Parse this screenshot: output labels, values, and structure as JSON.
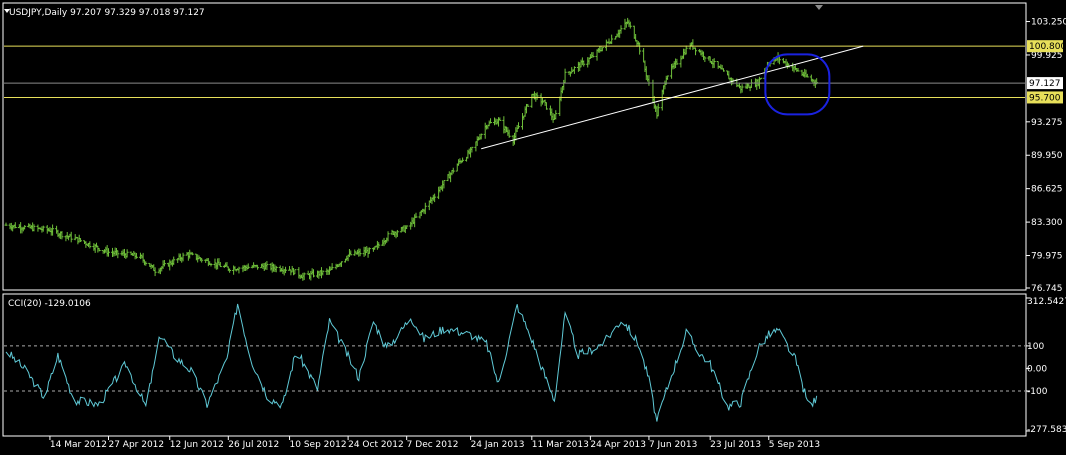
{
  "header": {
    "symbol_line": "USDJPY,Daily  97.207 97.329 97.018 97.127",
    "indicator_line": "CCI(20) -129.0106"
  },
  "colors": {
    "background": "#000000",
    "frame": "#ffffff",
    "bar": "#6fbf3a",
    "cci": "#5fc9d6",
    "hline": "#e8e05a",
    "trend": "#ffffff",
    "circle": "#1a22e0",
    "grid": "#8a8a8a"
  },
  "chart_data": [
    {
      "type": "ohlc",
      "symbol": "USDJPY",
      "timeframe": "Daily",
      "ylim": [
        76.745,
        104.0
      ],
      "y_ticks": [
        "103.250",
        "99.925",
        "93.275",
        "89.950",
        "86.625",
        "83.300",
        "79.975",
        "76.745"
      ],
      "x_ticks": [
        "14 Mar 2012",
        "27 Apr 2012",
        "12 Jun 2012",
        "26 Jul 2012",
        "10 Sep 2012",
        "24 Oct 2012",
        "7 Dec 2012",
        "24 Jan 2013",
        "11 Mar 2013",
        "24 Apr 2013",
        "7 Jun 2013",
        "23 Jul 2013",
        "5 Sep 2013"
      ],
      "last": {
        "open": 97.207,
        "high": 97.329,
        "low": 97.018,
        "close": 97.127
      },
      "price_tags": [
        {
          "label": "100.800",
          "value": 100.8,
          "style": "yellow"
        },
        {
          "label": "97.127",
          "value": 97.127,
          "style": "white"
        },
        {
          "label": "95.700",
          "value": 95.7,
          "style": "yellow"
        }
      ],
      "horizontal_lines": [
        100.8,
        95.7
      ],
      "current_price_line": 97.127,
      "trendline": {
        "from": [
          "2013-02-01",
          90.6
        ],
        "to": [
          "2013-11-15",
          100.8
        ]
      },
      "annotation": {
        "shape": "rounded-rectangle",
        "around": [
          "2013-09-25",
          97.0
        ]
      },
      "x_start": "2012-02-10",
      "x_end": "2013-10-12",
      "anchors": [
        [
          "2012-02-10",
          83.0
        ],
        [
          "2012-03-14",
          82.5
        ],
        [
          "2012-04-05",
          81.5
        ],
        [
          "2012-04-27",
          80.3
        ],
        [
          "2012-05-20",
          79.9
        ],
        [
          "2012-06-01",
          78.5
        ],
        [
          "2012-06-12",
          79.2
        ],
        [
          "2012-06-25",
          80.1
        ],
        [
          "2012-07-26",
          78.7
        ],
        [
          "2012-08-20",
          78.9
        ],
        [
          "2012-09-10",
          78.6
        ],
        [
          "2012-09-20",
          77.9
        ],
        [
          "2012-10-10",
          78.4
        ],
        [
          "2012-10-24",
          80.0
        ],
        [
          "2012-11-12",
          80.5
        ],
        [
          "2012-11-25",
          82.2
        ],
        [
          "2012-12-07",
          82.7
        ],
        [
          "2012-12-20",
          84.6
        ],
        [
          "2012-12-31",
          86.5
        ],
        [
          "2013-01-15",
          89.2
        ],
        [
          "2013-01-24",
          90.3
        ],
        [
          "2013-02-05",
          93.0
        ],
        [
          "2013-02-14",
          93.4
        ],
        [
          "2013-02-25",
          91.5
        ],
        [
          "2013-03-11",
          96.0
        ],
        [
          "2013-03-20",
          95.2
        ],
        [
          "2013-03-28",
          93.4
        ],
        [
          "2013-04-05",
          98.0
        ],
        [
          "2013-04-24",
          99.6
        ],
        [
          "2013-05-10",
          101.5
        ],
        [
          "2013-05-22",
          103.2
        ],
        [
          "2013-05-30",
          101.0
        ],
        [
          "2013-06-07",
          97.0
        ],
        [
          "2013-06-13",
          94.0
        ],
        [
          "2013-06-20",
          97.8
        ],
        [
          "2013-06-28",
          99.2
        ],
        [
          "2013-07-08",
          101.0
        ],
        [
          "2013-07-23",
          99.4
        ],
        [
          "2013-08-05",
          97.8
        ],
        [
          "2013-08-15",
          96.6
        ],
        [
          "2013-08-28",
          97.2
        ],
        [
          "2013-09-05",
          99.2
        ],
        [
          "2013-09-12",
          99.6
        ],
        [
          "2013-09-25",
          98.5
        ],
        [
          "2013-10-05",
          97.6
        ],
        [
          "2013-10-12",
          97.13
        ]
      ]
    },
    {
      "type": "line",
      "name": "CCI(20)",
      "ylim": [
        -277.583,
        312.5427
      ],
      "y_ticks": [
        "312.5427",
        "100",
        "0.00",
        "-100",
        "-277.583"
      ],
      "levels": [
        100,
        -100
      ],
      "last_value": -129.0106,
      "x_start": "2012-02-10",
      "x_end": "2013-10-12",
      "anchors": [
        [
          "2012-02-10",
          80
        ],
        [
          "2012-02-25",
          -10
        ],
        [
          "2012-03-10",
          -130
        ],
        [
          "2012-03-20",
          60
        ],
        [
          "2012-04-01",
          -140
        ],
        [
          "2012-04-20",
          -160
        ],
        [
          "2012-05-10",
          20
        ],
        [
          "2012-05-25",
          -170
        ],
        [
          "2012-06-05",
          150
        ],
        [
          "2012-06-15",
          60
        ],
        [
          "2012-06-28",
          -10
        ],
        [
          "2012-07-10",
          -160
        ],
        [
          "2012-07-25",
          40
        ],
        [
          "2012-08-02",
          290
        ],
        [
          "2012-08-12",
          40
        ],
        [
          "2012-08-25",
          -130
        ],
        [
          "2012-09-05",
          -160
        ],
        [
          "2012-09-15",
          80
        ],
        [
          "2012-10-01",
          -90
        ],
        [
          "2012-10-10",
          210
        ],
        [
          "2012-10-20",
          100
        ],
        [
          "2012-11-01",
          -40
        ],
        [
          "2012-11-12",
          210
        ],
        [
          "2012-11-22",
          90
        ],
        [
          "2012-12-01",
          150
        ],
        [
          "2012-12-10",
          230
        ],
        [
          "2012-12-20",
          130
        ],
        [
          "2013-01-05",
          180
        ],
        [
          "2013-01-24",
          150
        ],
        [
          "2013-02-05",
          110
        ],
        [
          "2013-02-14",
          -70
        ],
        [
          "2013-02-28",
          280
        ],
        [
          "2013-03-11",
          130
        ],
        [
          "2013-03-20",
          -20
        ],
        [
          "2013-03-28",
          -140
        ],
        [
          "2013-04-05",
          240
        ],
        [
          "2013-04-15",
          60
        ],
        [
          "2013-04-24",
          80
        ],
        [
          "2013-05-05",
          120
        ],
        [
          "2013-05-18",
          220
        ],
        [
          "2013-05-30",
          110
        ],
        [
          "2013-06-07",
          -50
        ],
        [
          "2013-06-13",
          -240
        ],
        [
          "2013-06-20",
          -100
        ],
        [
          "2013-07-05",
          160
        ],
        [
          "2013-07-15",
          70
        ],
        [
          "2013-07-23",
          20
        ],
        [
          "2013-08-05",
          -170
        ],
        [
          "2013-08-15",
          -150
        ],
        [
          "2013-08-28",
          90
        ],
        [
          "2013-09-05",
          150
        ],
        [
          "2013-09-12",
          170
        ],
        [
          "2013-09-25",
          40
        ],
        [
          "2013-10-05",
          -170
        ],
        [
          "2013-10-12",
          -129
        ]
      ]
    }
  ]
}
